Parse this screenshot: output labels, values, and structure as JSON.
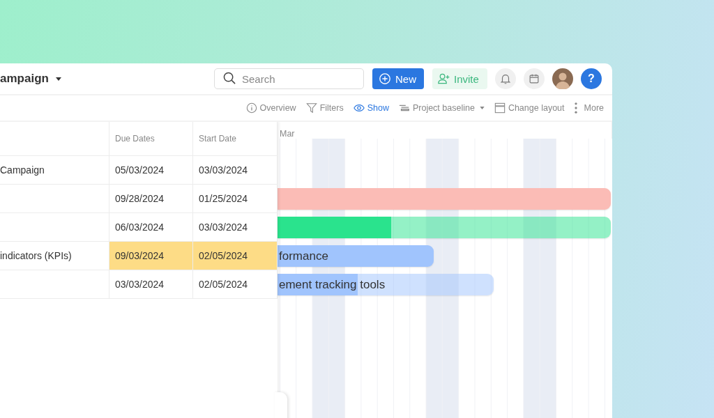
{
  "project": {
    "title": "ampaign"
  },
  "header": {
    "search": {
      "placeholder": "Search"
    },
    "new_button": "New",
    "invite_button": "Invite",
    "help_button": "?"
  },
  "toolbar": [
    {
      "kind": "info",
      "label": "Overview",
      "selected": false
    },
    {
      "kind": "filter",
      "label": "Filters",
      "selected": false
    },
    {
      "kind": "eye",
      "label": "Show",
      "selected": true
    },
    {
      "kind": "baseline",
      "label": "Project baseline",
      "selected": false
    },
    {
      "kind": "layout",
      "label": "Change layout",
      "selected": false
    },
    {
      "kind": "more",
      "label": "More",
      "selected": false
    }
  ],
  "table": {
    "columns": [
      "Due Dates",
      "Start Date"
    ],
    "rows": [
      {
        "name": "Campaign",
        "due_date": "05/03/2024",
        "start_date": "03/03/2024",
        "highlighted": false
      },
      {
        "due_date": "09/28/2024",
        "start_date": "01/25/2024",
        "highlighted": false,
        "bar": {
          "color": "#fbbcb6",
          "level": 1
        }
      },
      {
        "due_date": "06/03/2024",
        "start_date": "03/03/2024",
        "highlighted": false,
        "bar": {
          "color": "#2ae38d",
          "level": 0.34
        }
      },
      {
        "name": "indicators (KPIs)",
        "due_date": "09/03/2024",
        "start_date": "02/05/2024",
        "highlighted": true,
        "bar": {
          "color": "#a0c4fd",
          "level": 1,
          "label": "formance"
        }
      },
      {
        "due_date": "03/03/2024",
        "start_date": "02/05/2024",
        "highlighted": false,
        "bar": {
          "color": "#a0c4fd",
          "level": 0.37,
          "label": "ement tracking tools"
        }
      }
    ]
  },
  "timeline": {
    "month": "Mar"
  }
}
